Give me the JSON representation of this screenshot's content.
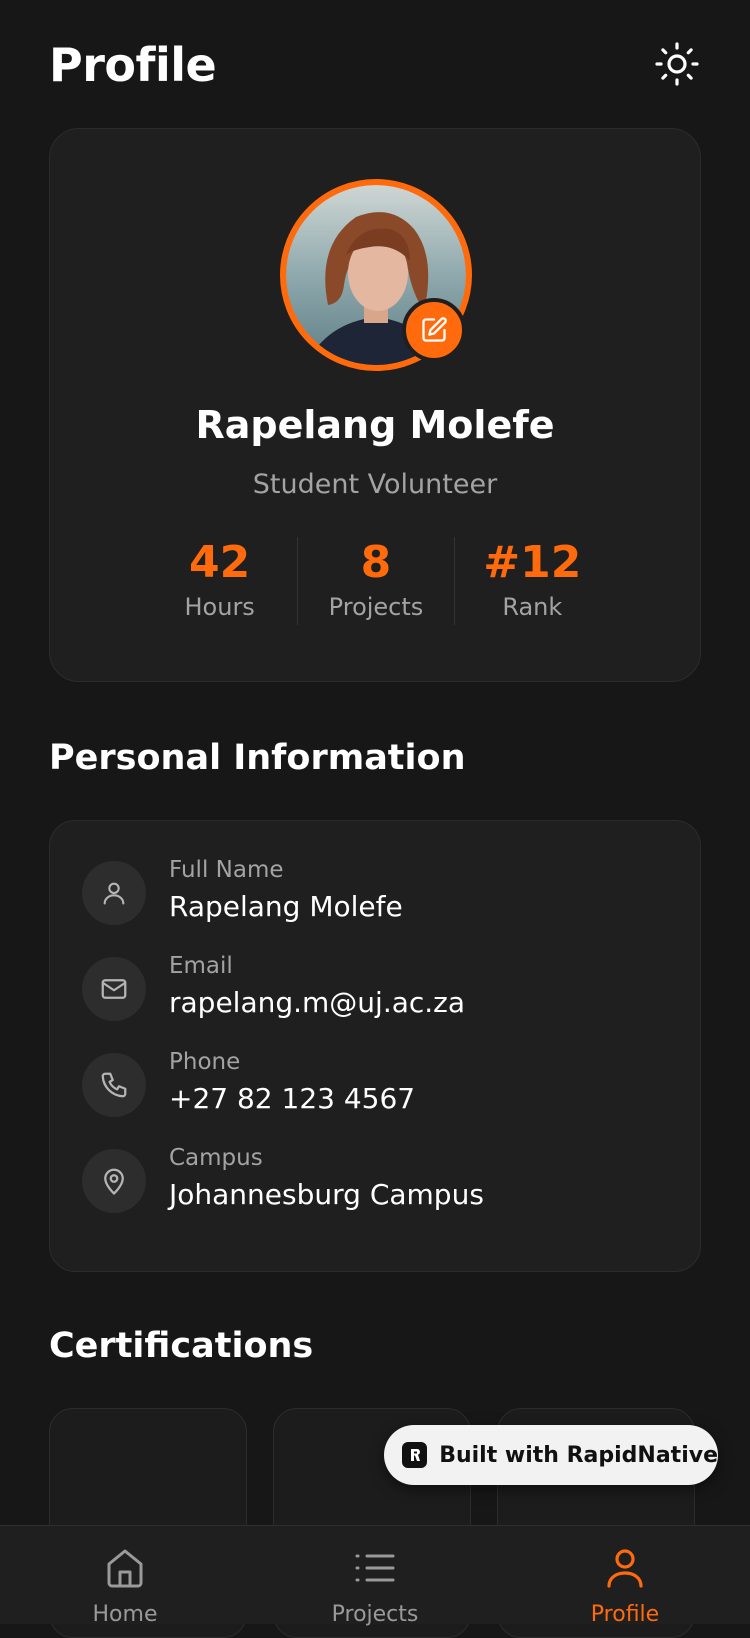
{
  "header": {
    "title": "Profile",
    "theme_icon": "sun-icon"
  },
  "profile": {
    "name": "Rapelang Molefe",
    "role": "Student Volunteer",
    "stats": [
      {
        "value": "42",
        "label": "Hours"
      },
      {
        "value": "8",
        "label": "Projects"
      },
      {
        "value": "#12",
        "label": "Rank"
      }
    ]
  },
  "personal_info": {
    "title": "Personal Information",
    "rows": [
      {
        "label": "Full Name",
        "value": "Rapelang Molefe",
        "icon": "user-icon"
      },
      {
        "label": "Email",
        "value": "rapelang.m@uj.ac.za",
        "icon": "mail-icon"
      },
      {
        "label": "Phone",
        "value": "+27 82 123 4567",
        "icon": "phone-icon"
      },
      {
        "label": "Campus",
        "value": "Johannesburg Campus",
        "icon": "map-pin-icon"
      }
    ]
  },
  "certifications": {
    "title": "Certifications"
  },
  "badge": {
    "text": "Built with RapidNative"
  },
  "tabs": [
    {
      "label": "Home",
      "icon": "home-icon",
      "active": false
    },
    {
      "label": "Projects",
      "icon": "list-icon",
      "active": false
    },
    {
      "label": "Profile",
      "icon": "user-icon",
      "active": true
    }
  ],
  "colors": {
    "accent": "#ff6a0d",
    "background": "#171717",
    "card": "#1f1f1f",
    "muted": "#a3a3a3"
  }
}
